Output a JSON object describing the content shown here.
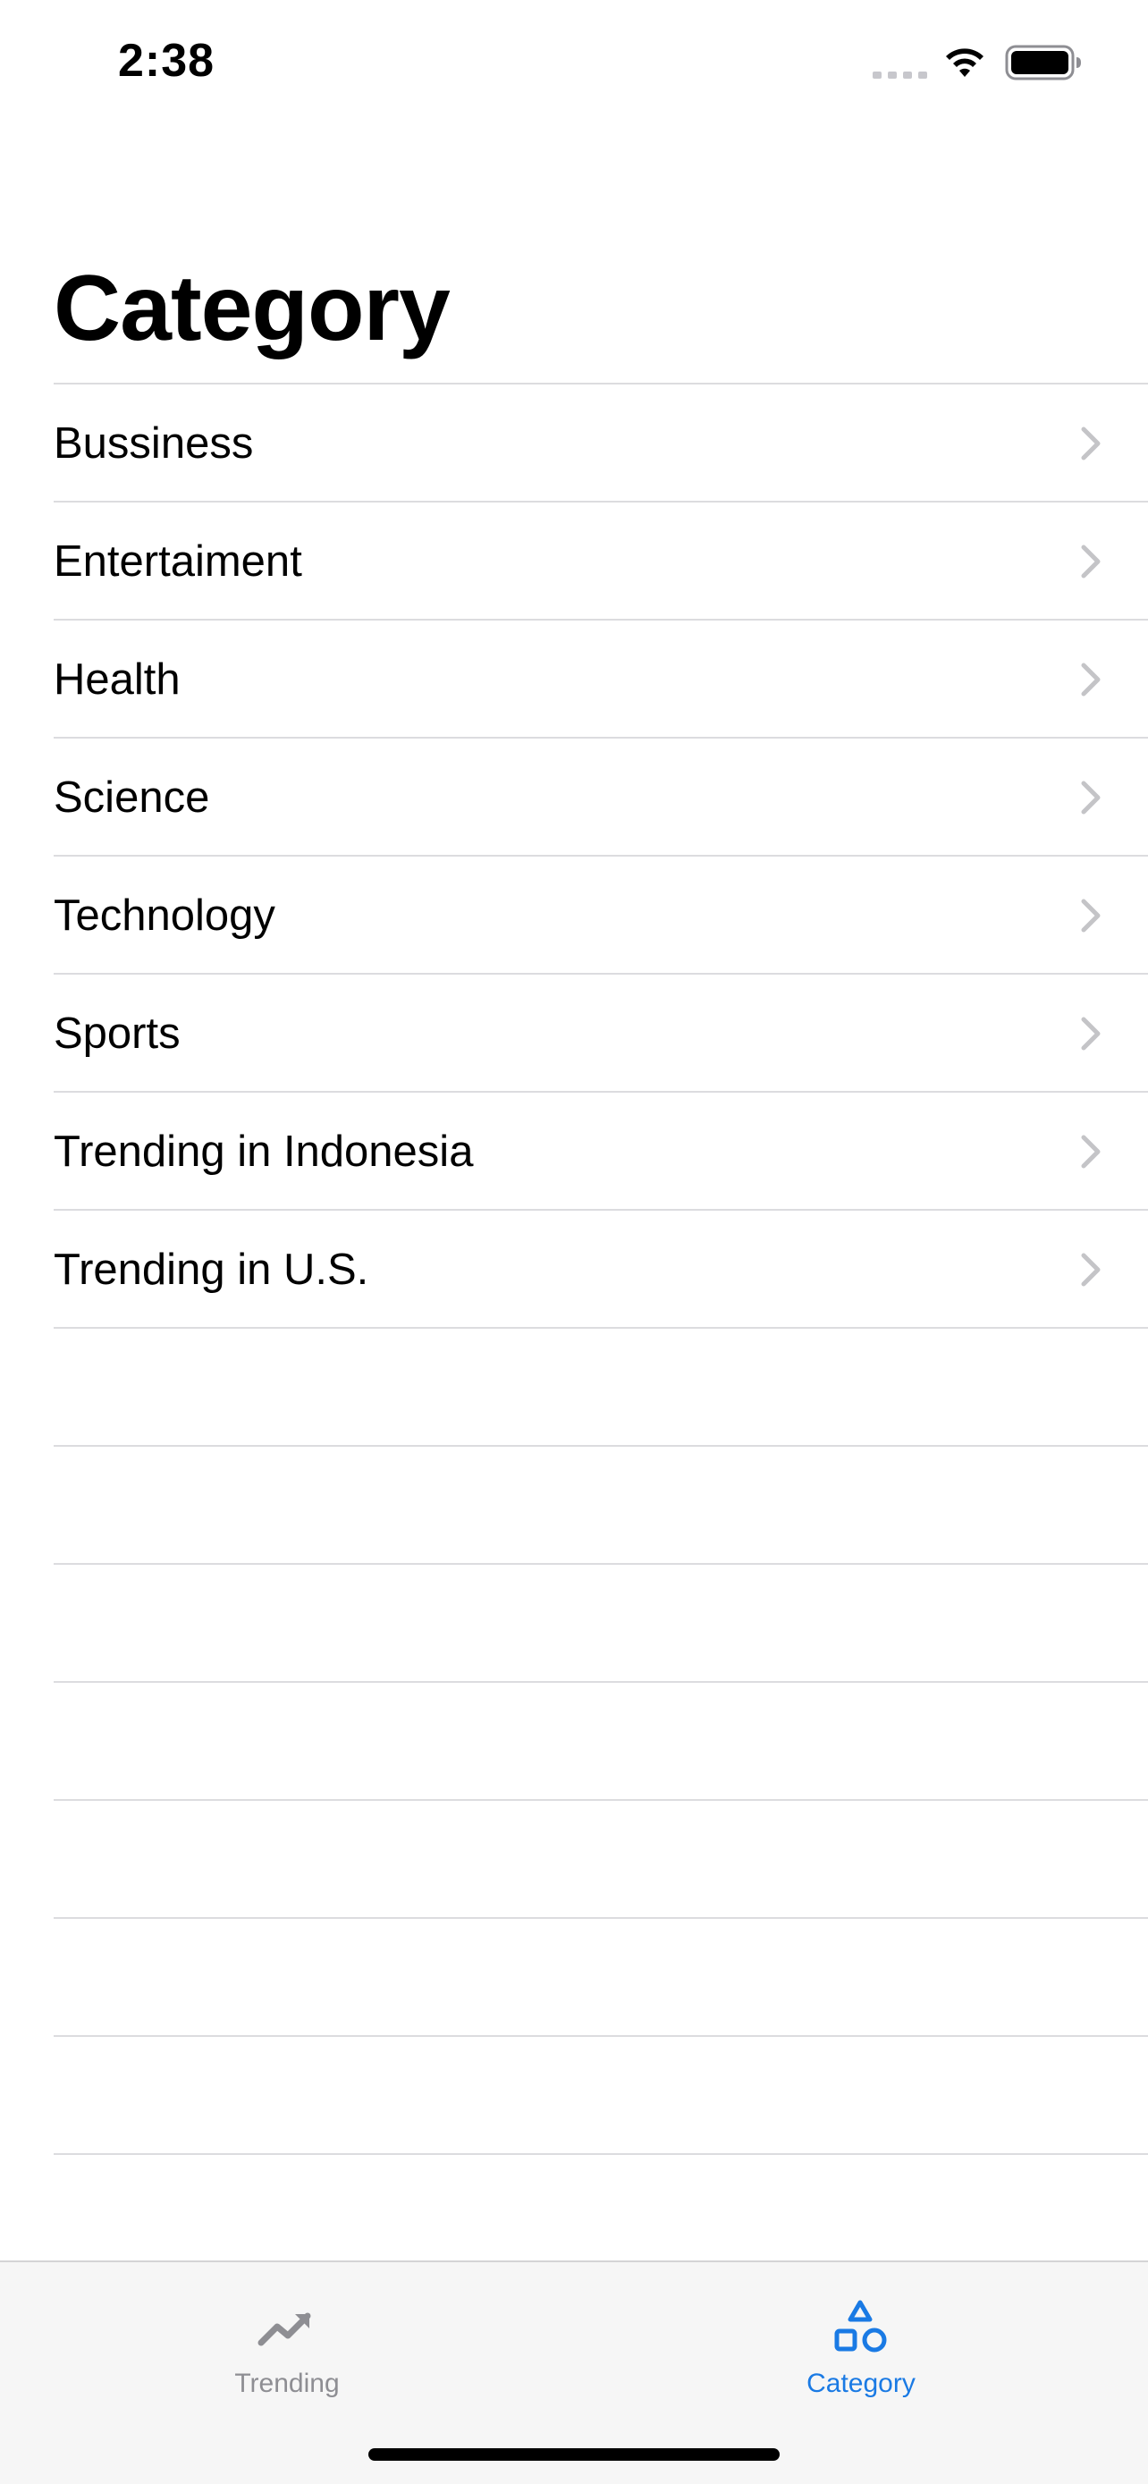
{
  "status_bar": {
    "time": "2:38",
    "signal_icon": "cellular-signal-icon",
    "wifi_icon": "wifi-icon",
    "battery_icon": "battery-icon"
  },
  "title": "Category",
  "categories": [
    {
      "label": "Bussiness",
      "icon": "chevron-right-icon"
    },
    {
      "label": "Entertaiment",
      "icon": "chevron-right-icon"
    },
    {
      "label": "Health",
      "icon": "chevron-right-icon"
    },
    {
      "label": "Science",
      "icon": "chevron-right-icon"
    },
    {
      "label": "Technology",
      "icon": "chevron-right-icon"
    },
    {
      "label": "Sports",
      "icon": "chevron-right-icon"
    },
    {
      "label": "Trending in Indonesia",
      "icon": "chevron-right-icon"
    },
    {
      "label": "Trending in U.S.",
      "icon": "chevron-right-icon"
    }
  ],
  "tab_bar": {
    "tabs": [
      {
        "label": "Trending",
        "icon": "trending-up-icon",
        "selected": false
      },
      {
        "label": "Category",
        "icon": "shapes-icon",
        "selected": true
      }
    ]
  },
  "colors": {
    "accent": "#1a7ae4",
    "inactive": "#8e8e93",
    "separator": "#dcdcdf",
    "chevron": "#c4c4c7",
    "tab_bar_bg": "#f6f6f6"
  }
}
